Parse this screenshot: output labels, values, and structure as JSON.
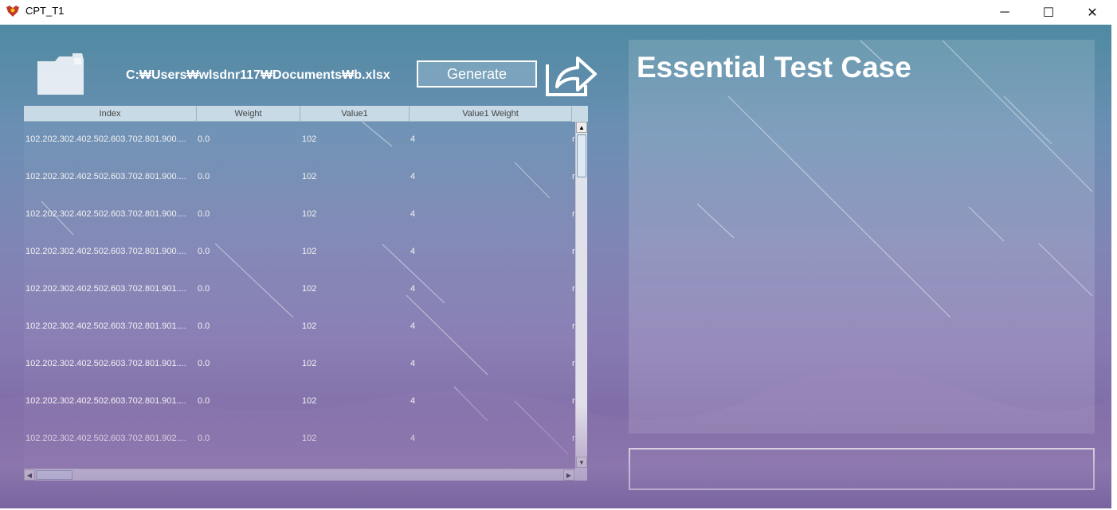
{
  "window": {
    "title": "CPT_T1",
    "minimize_label": "─",
    "maximize_label": "☐",
    "close_label": "✕"
  },
  "toolbar": {
    "file_path": "C:₩Users₩wlsdnr117₩Documents₩b.xlsx",
    "generate_label": "Generate"
  },
  "table": {
    "columns": [
      "Index",
      "Weight",
      "Value1",
      "Value1 Weight"
    ],
    "rows": [
      {
        "index": "102.202.302.402.502.603.702.801.900....",
        "weight": "0.0",
        "value1": "102",
        "value1_weight": "4",
        "next": "r"
      },
      {
        "index": "102.202.302.402.502.603.702.801.900....",
        "weight": "0.0",
        "value1": "102",
        "value1_weight": "4",
        "next": "r"
      },
      {
        "index": "102.202.302.402.502.603.702.801.900....",
        "weight": "0.0",
        "value1": "102",
        "value1_weight": "4",
        "next": "r"
      },
      {
        "index": "102.202.302.402.502.603.702.801.900....",
        "weight": "0.0",
        "value1": "102",
        "value1_weight": "4",
        "next": "r"
      },
      {
        "index": "102.202.302.402.502.603.702.801.901....",
        "weight": "0.0",
        "value1": "102",
        "value1_weight": "4",
        "next": "r"
      },
      {
        "index": "102.202.302.402.502.603.702.801.901....",
        "weight": "0.0",
        "value1": "102",
        "value1_weight": "4",
        "next": "r"
      },
      {
        "index": "102.202.302.402.502.603.702.801.901....",
        "weight": "0.0",
        "value1": "102",
        "value1_weight": "4",
        "next": "r"
      },
      {
        "index": "102.202.302.402.502.603.702.801.901....",
        "weight": "0.0",
        "value1": "102",
        "value1_weight": "4",
        "next": "r"
      },
      {
        "index": "102.202.302.402.502.603.702.801.902....",
        "weight": "0.0",
        "value1": "102",
        "value1_weight": "4",
        "next": "r"
      }
    ]
  },
  "results": {
    "title": "Essential Test Case",
    "status_text": ""
  },
  "icons": {
    "app": "app-logo-icon",
    "open_file": "folder-open-icon",
    "export": "export-share-icon"
  },
  "colors": {
    "header_bg": "#c7dae6",
    "bg_top": "#4f8aa1",
    "bg_bottom": "#6f5d98",
    "text": "#ffffff"
  }
}
